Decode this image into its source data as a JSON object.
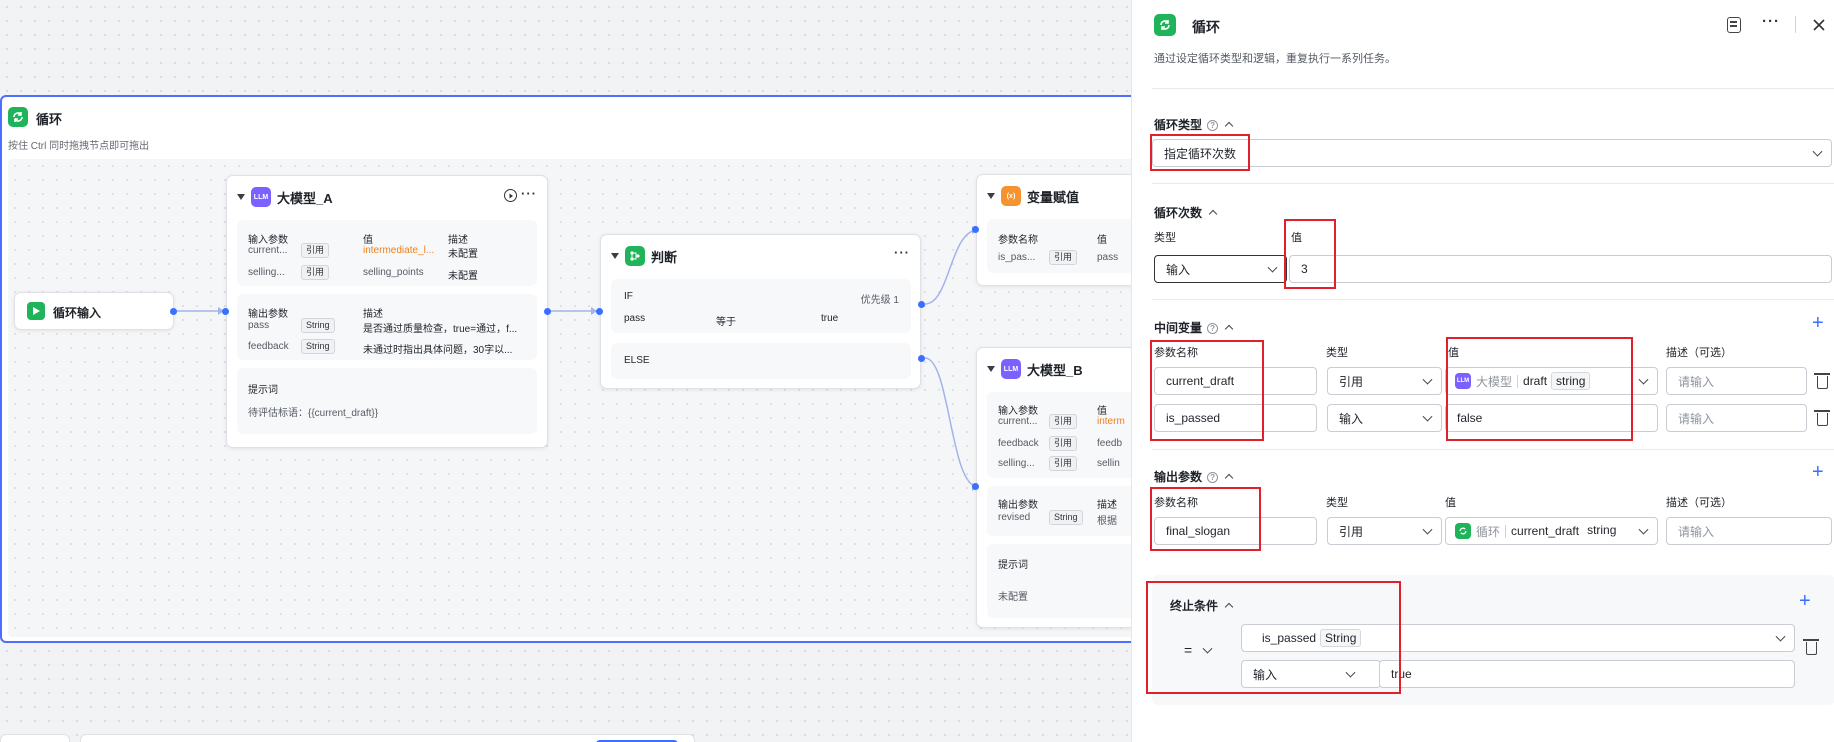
{
  "loop_node": {
    "title": "循环",
    "subtitle": "按住 Ctrl 同时拖拽节点即可拖出"
  },
  "loop_input": {
    "title": "循环输入"
  },
  "llm_a": {
    "title": "大模型_A",
    "icon_text": "LLM",
    "input_header": "输入参数",
    "value_header": "值",
    "desc_header": "描述",
    "inputs": [
      {
        "name": "current...",
        "type": "引用",
        "value": "intermediate_l...",
        "desc": "未配置"
      },
      {
        "name": "selling...",
        "type": "引用",
        "value": "selling_points",
        "desc": "未配置"
      }
    ],
    "output_header": "输出参数",
    "output_desc_header": "描述",
    "outputs": [
      {
        "name": "pass",
        "type": "String",
        "desc": "是否通过质量检查，true=通过，f..."
      },
      {
        "name": "feedback",
        "type": "String",
        "desc": "未通过时指出具体问题，30字以..."
      }
    ],
    "prompt_label": "提示词",
    "prompt_value": "待评估标语：{{current_draft}}"
  },
  "judge": {
    "title": "判断",
    "if_label": "IF",
    "priority": "优先级 1",
    "cond_left": "pass",
    "cond_op": "等于",
    "cond_right": "true",
    "else_label": "ELSE"
  },
  "var_assign": {
    "title": "变量赋值",
    "icon_text": "(x)",
    "param_header": "参数名称",
    "value_header": "值",
    "row_name": "is_pas...",
    "row_type": "引用",
    "row_value": "pass"
  },
  "llm_b": {
    "title": "大模型_B",
    "icon_text": "LLM",
    "input_header": "输入参数",
    "value_header": "值",
    "inputs": [
      {
        "name": "current...",
        "type": "引用",
        "value": "interm"
      },
      {
        "name": "feedback",
        "type": "引用",
        "value": "feedb"
      },
      {
        "name": "selling...",
        "type": "引用",
        "value": "sellin"
      }
    ],
    "output_header": "输出参数",
    "desc_header": "描述",
    "output_name": "revised",
    "output_type": "String",
    "output_desc": "根据",
    "prompt_label": "提示词",
    "prompt_value": "未配置"
  },
  "panel": {
    "title": "循环",
    "description": "通过设定循环类型和逻辑，重复执行一系列任务。",
    "loop_type": {
      "label": "循环类型",
      "value": "指定循环次数"
    },
    "loop_count": {
      "label": "循环次数",
      "type_header": "类型",
      "value_header": "值",
      "type_value": "输入",
      "value": "3"
    },
    "intermediate": {
      "label": "中间变量",
      "headers": {
        "name": "参数名称",
        "type": "类型",
        "value": "值",
        "desc": "描述（可选）"
      },
      "rows": [
        {
          "name": "current_draft",
          "type": "引用",
          "source": "大模型",
          "field": "draft",
          "dtype": "string",
          "desc_placeholder": "请输入"
        },
        {
          "name": "is_passed",
          "type": "输入",
          "value": "false",
          "desc_placeholder": "请输入"
        }
      ]
    },
    "output": {
      "label": "输出参数",
      "headers": {
        "name": "参数名称",
        "type": "类型",
        "value": "值",
        "desc": "描述（可选）"
      },
      "row": {
        "name": "final_slogan",
        "type": "引用",
        "source": "循环",
        "field": "current_draft",
        "dtype": "string",
        "desc_placeholder": "请输入"
      }
    },
    "terminate": {
      "label": "终止条件",
      "operator": "=",
      "left_var": "is_passed",
      "left_type": "String",
      "right_type": "输入",
      "right_value": "true"
    }
  },
  "colors": {
    "accent": "#3a6fff",
    "loop_green": "#1fb35a",
    "llm_purple": "#7b61ff",
    "var_orange": "#f5932f",
    "highlight_red": "#e0212b"
  }
}
